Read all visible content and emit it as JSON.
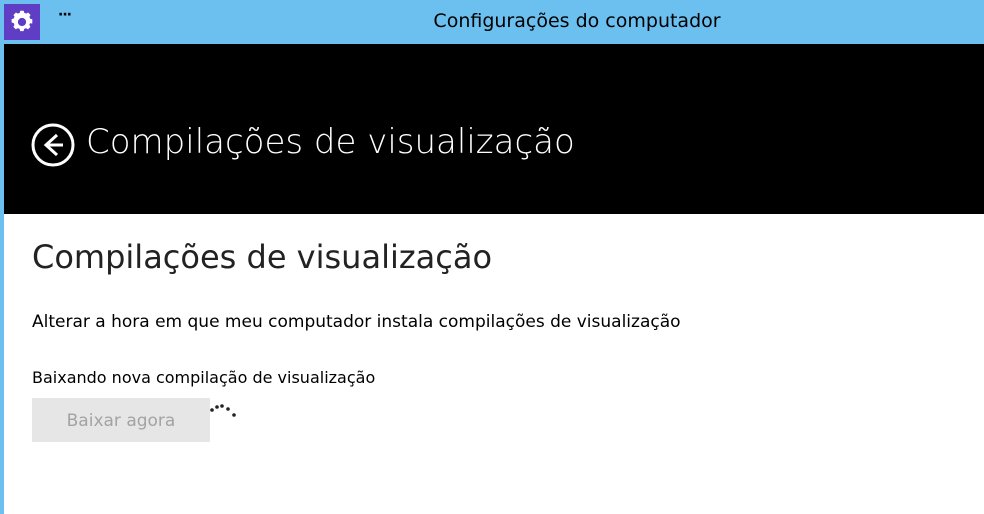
{
  "window": {
    "title": "Configurações do computador",
    "app_icon": "gear-icon",
    "more_icon": "ellipsis-icon",
    "more_label": "···"
  },
  "header": {
    "back_icon": "back-arrow-icon",
    "title": "Compilações de visualização"
  },
  "content": {
    "section_title": "Compilações de visualização",
    "link_text": "Alterar a hora em que meu computador instala compilações de visualização",
    "status_text": "Baixando nova compilação de visualização",
    "download_button_label": "Baixar agora",
    "download_button_enabled": false
  },
  "colors": {
    "titlebar": "#6cc0ef",
    "app_icon_bg": "#5f3dc4",
    "header_bg": "#000000",
    "disabled_button_bg": "#e6e6e6",
    "disabled_button_text": "#a3a3a3"
  }
}
